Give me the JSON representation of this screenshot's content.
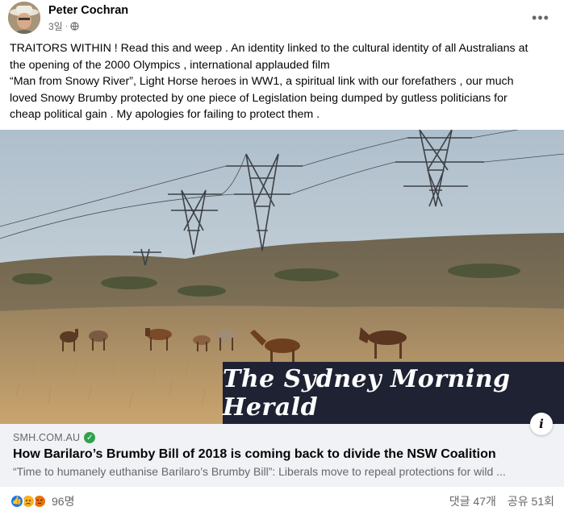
{
  "post": {
    "author": "Peter Cochran",
    "time": "3일",
    "dot": "·",
    "more": "•••",
    "text_lines": [
      "TRAITORS WITHIN ! Read this and weep . An identity linked to the cultural identity of all Australians at",
      "the opening of the 2000 Olympics , international applauded film",
      "“Man from Snowy River”, Light Horse heroes in WW1, a spiritual link with our forefathers , our much",
      "loved Snowy Brumby protected by one piece of Legislation being dumped by gutless politicians for",
      "cheap political gain . My apologies for failing to protect them ."
    ]
  },
  "image": {
    "masthead": "The Sydney Morning Herald"
  },
  "link": {
    "domain": "SMH.COM.AU",
    "title": "How Barilaro’s Brumby Bill of 2018 is coming back to divide the NSW Coalition",
    "description": "“Time to humanely euthanise Barilaro’s Brumby Bill”: Liberals move to repeal protections for wild ..."
  },
  "footer": {
    "reaction_count": "96명",
    "comments": "댓글 47개",
    "shares": "공유 51회"
  },
  "colors": {
    "like": "#1877f2",
    "sad": "#f7b125",
    "angry": "#e9710f",
    "verified": "#31a24c",
    "masthead_bg": "#1e2233"
  },
  "icons": [
    "globe-icon",
    "more-options-icon",
    "info-icon",
    "verified-check-icon",
    "like-reaction-icon",
    "sad-reaction-icon",
    "angry-reaction-icon"
  ]
}
